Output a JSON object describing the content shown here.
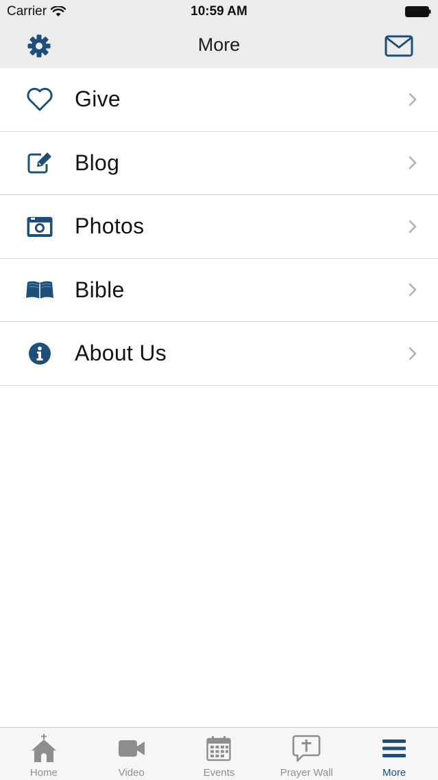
{
  "status_bar": {
    "carrier": "Carrier",
    "time": "10:59 AM"
  },
  "nav": {
    "title": "More",
    "left_icon": "gear-icon",
    "right_icon": "mail-icon"
  },
  "menu": [
    {
      "label": "Give",
      "icon": "heart-icon"
    },
    {
      "label": "Blog",
      "icon": "edit-icon"
    },
    {
      "label": "Photos",
      "icon": "camera-icon"
    },
    {
      "label": "Bible",
      "icon": "book-icon"
    },
    {
      "label": "About Us",
      "icon": "info-icon"
    }
  ],
  "tabs": [
    {
      "label": "Home",
      "icon": "church-icon",
      "active": false
    },
    {
      "label": "Video",
      "icon": "video-camera-icon",
      "active": false
    },
    {
      "label": "Events",
      "icon": "calendar-icon",
      "active": false
    },
    {
      "label": "Prayer Wall",
      "icon": "prayer-bubble-icon",
      "active": false
    },
    {
      "label": "More",
      "icon": "menu-icon",
      "active": true
    }
  ],
  "colors": {
    "accent": "#1d4f7a",
    "tab_inactive": "#8e8e8e",
    "header_bg": "#ececec",
    "divider": "#d8d8d8"
  }
}
